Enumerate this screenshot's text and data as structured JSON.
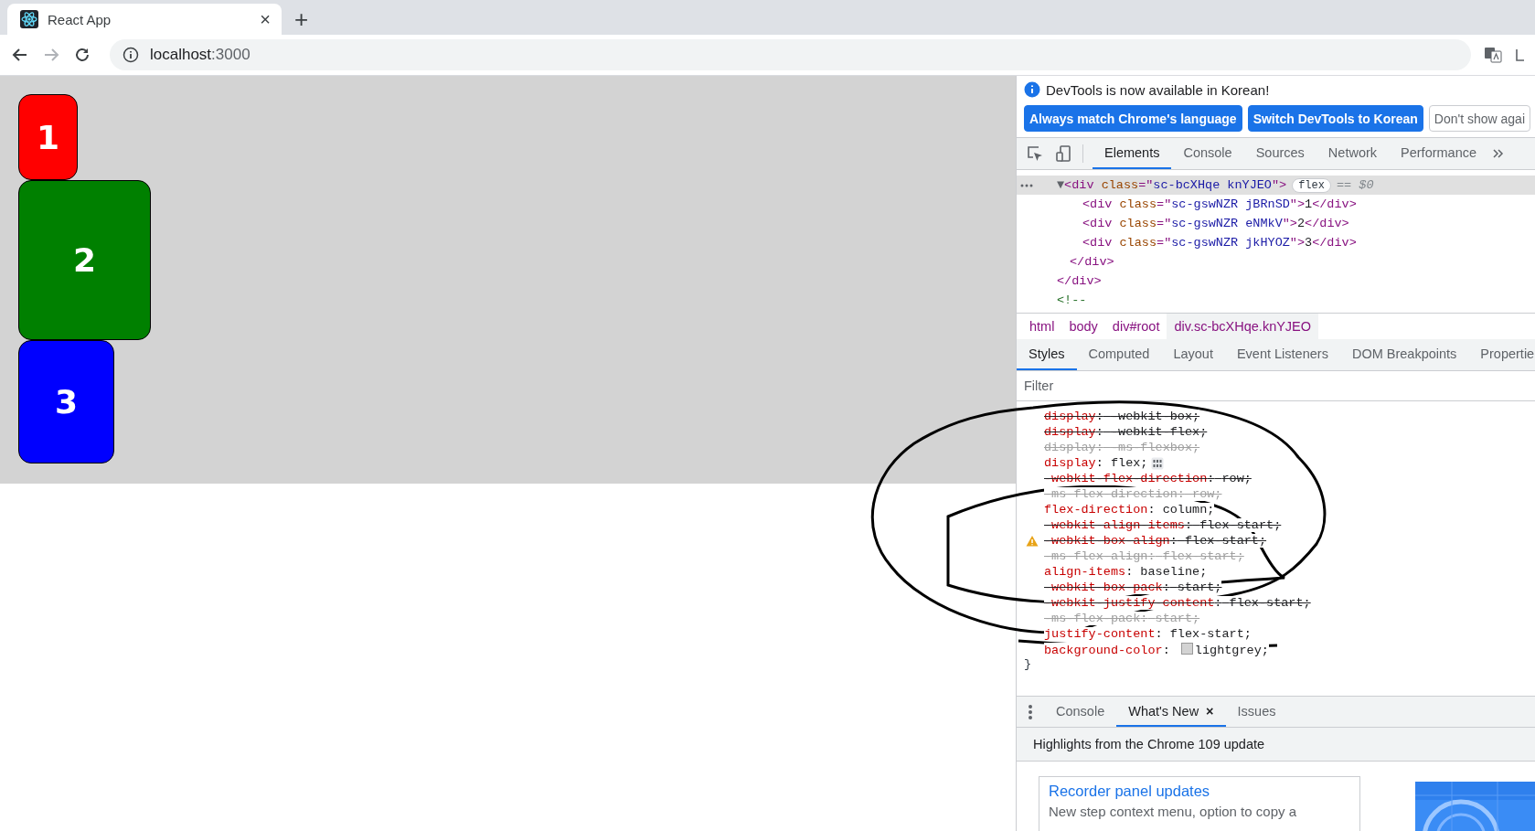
{
  "browser": {
    "tab": {
      "title": "React App",
      "close": "×"
    },
    "new_tab": "+",
    "address": {
      "host": "localhost",
      "port": ":3000"
    }
  },
  "page": {
    "boxes": [
      {
        "label": "1",
        "color": "#ff0000"
      },
      {
        "label": "2",
        "color": "#008000"
      },
      {
        "label": "3",
        "color": "#0000ff"
      }
    ]
  },
  "devtools": {
    "infobar": {
      "message": "DevTools is now available in Korean!",
      "buttons": [
        {
          "label": "Always match Chrome's language",
          "kind": "primary"
        },
        {
          "label": "Switch DevTools to Korean",
          "kind": "primary"
        },
        {
          "label": "Don't show agai",
          "kind": "secondary"
        }
      ]
    },
    "tabs": [
      {
        "label": "Elements",
        "selected": true
      },
      {
        "label": "Console",
        "selected": false
      },
      {
        "label": "Sources",
        "selected": false
      },
      {
        "label": "Network",
        "selected": false
      },
      {
        "label": "Performance",
        "selected": false
      }
    ],
    "dom": {
      "selected_node": {
        "toggle": "▼",
        "tokens": [
          {
            "kind": "tag",
            "text": "<div "
          },
          {
            "kind": "attr",
            "text": "class"
          },
          {
            "kind": "tag",
            "text": "=\""
          },
          {
            "kind": "value",
            "text": "sc-bcXHqe knYJEO"
          },
          {
            "kind": "tag",
            "text": "\">"
          }
        ],
        "badge": "flex",
        "marker": "== $0",
        "selected": true,
        "children": [
          {
            "tokens": [
              {
                "kind": "tag",
                "text": "<div "
              },
              {
                "kind": "attr",
                "text": "class"
              },
              {
                "kind": "tag",
                "text": "=\""
              },
              {
                "kind": "value",
                "text": "sc-gswNZR jBRnSD"
              },
              {
                "kind": "tag",
                "text": "\">"
              },
              {
                "kind": "text",
                "text": "1"
              },
              {
                "kind": "tag",
                "text": "</div>"
              }
            ]
          },
          {
            "tokens": [
              {
                "kind": "tag",
                "text": "<div "
              },
              {
                "kind": "attr",
                "text": "class"
              },
              {
                "kind": "tag",
                "text": "=\""
              },
              {
                "kind": "value",
                "text": "sc-gswNZR eNMkV"
              },
              {
                "kind": "tag",
                "text": "\">"
              },
              {
                "kind": "text",
                "text": "2"
              },
              {
                "kind": "tag",
                "text": "</div>"
              }
            ]
          },
          {
            "tokens": [
              {
                "kind": "tag",
                "text": "<div "
              },
              {
                "kind": "attr",
                "text": "class"
              },
              {
                "kind": "tag",
                "text": "=\""
              },
              {
                "kind": "value",
                "text": "sc-gswNZR jkHYOZ"
              },
              {
                "kind": "tag",
                "text": "\">"
              },
              {
                "kind": "text",
                "text": "3"
              },
              {
                "kind": "tag",
                "text": "</div>"
              }
            ]
          }
        ],
        "close": "</div>"
      },
      "after": [
        {
          "kind": "tag",
          "text": "</div>"
        },
        {
          "kind": "comment",
          "text": "<!--"
        }
      ]
    },
    "breadcrumbs": [
      {
        "label": "html",
        "selected": false
      },
      {
        "label": "body",
        "selected": false
      },
      {
        "label": "div#root",
        "selected": false
      },
      {
        "label": "div.sc-bcXHqe.knYJEO",
        "selected": true
      }
    ],
    "pane_tabs": [
      {
        "label": "Styles",
        "selected": true
      },
      {
        "label": "Computed",
        "selected": false
      },
      {
        "label": "Layout",
        "selected": false
      },
      {
        "label": "Event Listeners",
        "selected": false
      },
      {
        "label": "DOM Breakpoints",
        "selected": false
      },
      {
        "label": "Propertie",
        "selected": false
      }
    ],
    "filter": {
      "placeholder": "Filter"
    },
    "declarations": [
      {
        "property": "display",
        "value": "-webkit-box;",
        "overridden": true,
        "invalid": false,
        "warning": false
      },
      {
        "property": "display",
        "value": "-webkit-flex;",
        "overridden": true,
        "invalid": false,
        "warning": false
      },
      {
        "property": "display",
        "value": "-ms-flexbox;",
        "overridden": false,
        "invalid": true,
        "warning": false
      },
      {
        "property": "display",
        "value": "flex;",
        "overridden": false,
        "invalid": false,
        "warning": false,
        "flex_editor": true
      },
      {
        "property": "-webkit-flex-direction",
        "value": "row;",
        "overridden": true,
        "invalid": false,
        "warning": false
      },
      {
        "property": "-ms-flex-direction",
        "value": "row;",
        "overridden": false,
        "invalid": true,
        "warning": false
      },
      {
        "property": "flex-direction",
        "value": "column;",
        "overridden": false,
        "invalid": false,
        "warning": false
      },
      {
        "property": "-webkit-align-items",
        "value": "flex-start;",
        "overridden": true,
        "invalid": false,
        "warning": false
      },
      {
        "property": "-webkit-box-align",
        "value": "flex-start;",
        "overridden": true,
        "invalid": false,
        "warning": true
      },
      {
        "property": "-ms-flex-align",
        "value": "flex-start;",
        "overridden": false,
        "invalid": true,
        "warning": false
      },
      {
        "property": "align-items",
        "value": "baseline;",
        "overridden": false,
        "invalid": false,
        "warning": false
      },
      {
        "property": "-webkit-box-pack",
        "value": "start;",
        "overridden": true,
        "invalid": false,
        "warning": false
      },
      {
        "property": "-webkit-justify-content",
        "value": "flex-start;",
        "overridden": true,
        "invalid": false,
        "warning": false
      },
      {
        "property": "-ms-flex-pack",
        "value": "start;",
        "overridden": false,
        "invalid": true,
        "warning": false
      },
      {
        "property": "justify-content",
        "value": "flex-start;",
        "overridden": false,
        "invalid": false,
        "warning": false
      },
      {
        "property": "background-color",
        "value": "lightgrey;",
        "overridden": false,
        "invalid": false,
        "warning": false,
        "color": "#d3d3d3"
      }
    ],
    "colon": ":",
    "rule_end": "}",
    "drawer": {
      "tabs": [
        {
          "label": "Console",
          "selected": false
        },
        {
          "label": "What's New",
          "selected": true,
          "close": "×"
        },
        {
          "label": "Issues",
          "selected": false
        }
      ],
      "headline": "Highlights from the Chrome 109 update",
      "card": {
        "title": "Recorder panel updates",
        "text": "New step context menu, option to copy a"
      }
    }
  }
}
